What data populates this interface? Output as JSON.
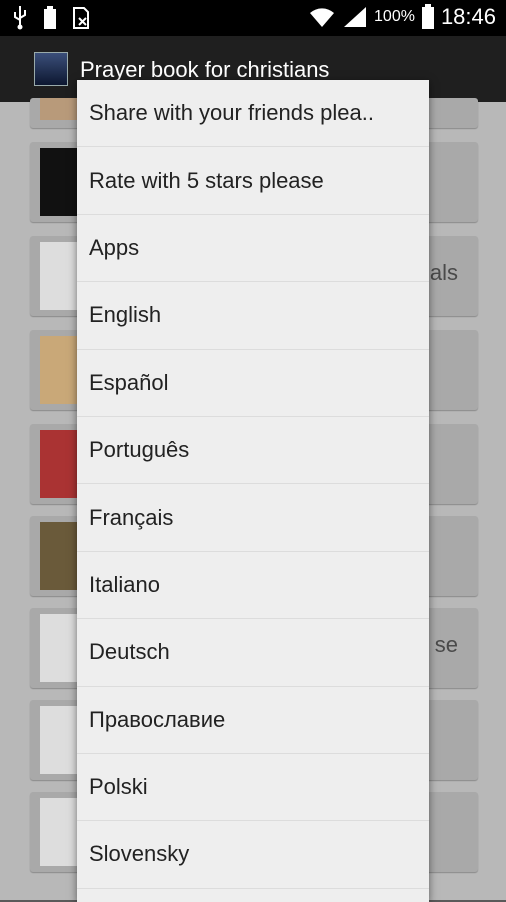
{
  "status_bar": {
    "battery_percent": "100%",
    "time": "18:46",
    "icons": [
      "usb-icon",
      "battery-notification-icon",
      "sd-card-icon",
      "wifi-icon",
      "signal-icon",
      "battery-icon"
    ]
  },
  "action_bar": {
    "title": "Prayer book for christians",
    "icon": "app-icon"
  },
  "background_list": {
    "partial_labels": [
      "als",
      "se"
    ]
  },
  "menu": {
    "items": [
      "Share with your friends plea..",
      "Rate with 5 stars please",
      "Apps",
      "English",
      "Español",
      "Português",
      "Français",
      "Italiano",
      "Deutsch",
      "Православие",
      "Polski",
      "Slovensky"
    ]
  }
}
